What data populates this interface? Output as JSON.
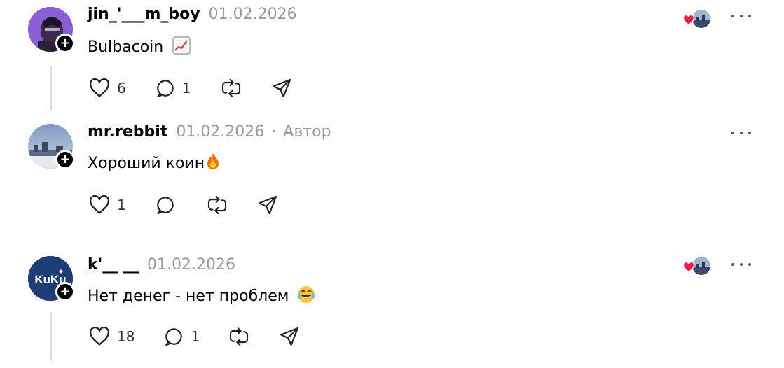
{
  "posts": [
    {
      "username": "jin_'___m_boy",
      "date": "01.02.2026",
      "author_tag": "",
      "text": "Bulbacoin",
      "text_emoji": "chart-increasing-icon",
      "likes": "6",
      "replies": "1",
      "has_liker": true
    },
    {
      "username": "mr.rebbit",
      "date": "01.02.2026",
      "separator": "·",
      "author_tag": "Автор",
      "text": "Хороший коин",
      "text_emoji": "fire-icon",
      "likes": "1",
      "replies": "",
      "has_liker": false
    },
    {
      "username": "k'__ __",
      "date": "01.02.2026",
      "author_tag": "",
      "text": "Нет денег - нет проблем",
      "text_emoji": "tears-of-joy-icon",
      "likes": "18",
      "replies": "1",
      "has_liker": true
    }
  ],
  "avatar_labels": {
    "kuku": "KuKu"
  },
  "colors": {
    "accent": "#000000",
    "muted": "#999999",
    "heart": "#ff1744",
    "thread": "#dddddd"
  }
}
